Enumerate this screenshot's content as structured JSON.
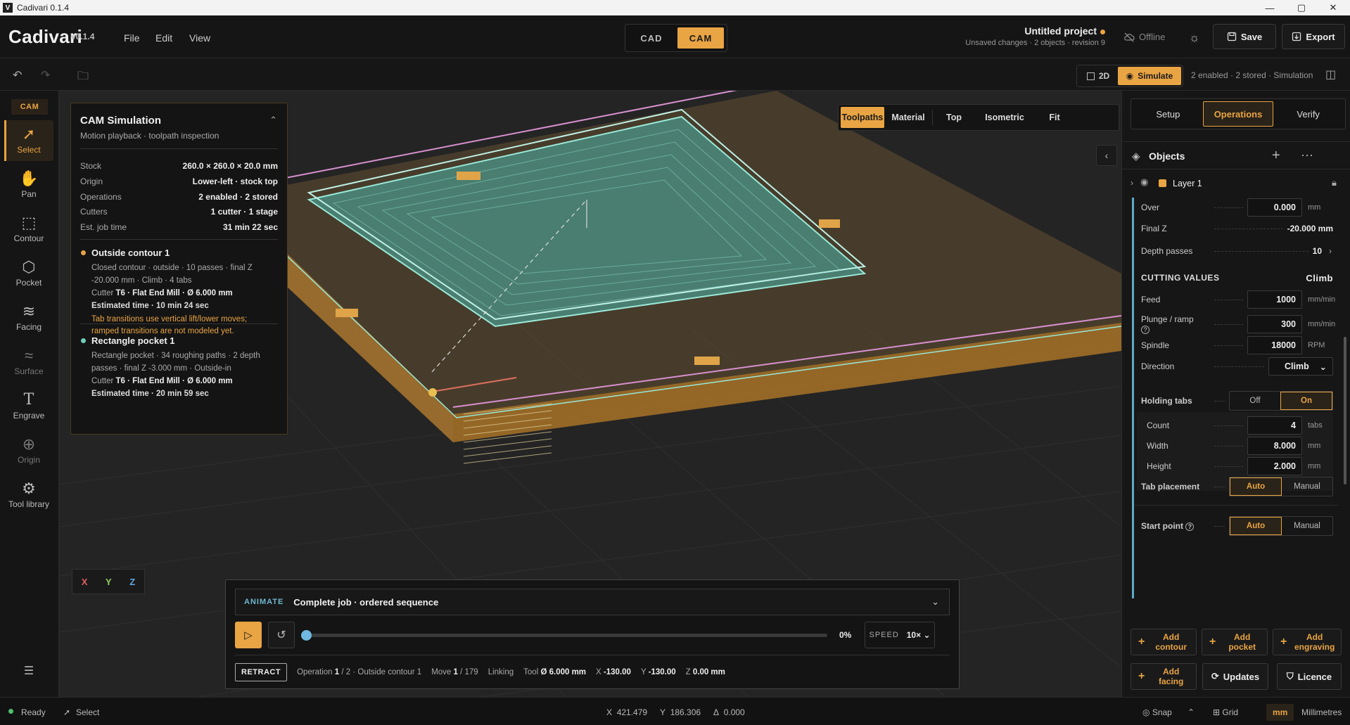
{
  "window": {
    "title": "Cadivari 0.1.4",
    "logo_letter": "V",
    "minimize": "—",
    "maximize": "▢",
    "close": "✕"
  },
  "brand": {
    "name": "Cadivari",
    "version": "v0.1.4"
  },
  "menu": {
    "file": "File",
    "edit": "Edit",
    "view": "View"
  },
  "mode": {
    "cad": "CAD",
    "cam": "CAM"
  },
  "project": {
    "title": "Untitled project",
    "subtitle": "Unsaved changes · 2 objects · revision 9"
  },
  "top_actions": {
    "offline": "Offline",
    "save": "Save",
    "export": "Export"
  },
  "toolbar": {
    "two_d": "2D",
    "simulate": "Simulate",
    "status": "2 enabled · 2 stored · Simulation"
  },
  "leftbar": {
    "badge": "CAM",
    "tools": [
      {
        "label": "Select",
        "icon": "cursor-icon"
      },
      {
        "label": "Pan",
        "icon": "hand-icon"
      },
      {
        "label": "Contour",
        "icon": "contour-icon"
      },
      {
        "label": "Pocket",
        "icon": "pocket-icon"
      },
      {
        "label": "Facing",
        "icon": "facing-icon"
      },
      {
        "label": "Surface",
        "icon": "surface-icon"
      },
      {
        "label": "Engrave",
        "icon": "engrave-icon"
      },
      {
        "label": "Origin",
        "icon": "origin-icon"
      },
      {
        "label": "Tool library",
        "icon": "tool-library-icon"
      }
    ]
  },
  "sim_panel": {
    "title": "CAM Simulation",
    "subtitle": "Motion playback · toolpath inspection",
    "rows": [
      {
        "k": "Stock",
        "v": "260.0 × 260.0 × 20.0 mm"
      },
      {
        "k": "Origin",
        "v": "Lower-left · stock top"
      },
      {
        "k": "Operations",
        "v": "2 enabled · 2 stored"
      },
      {
        "k": "Cutters",
        "v": "1 cutter · 1 stage"
      },
      {
        "k": "Est. job time",
        "v": "31 min 22 sec"
      }
    ],
    "ops": [
      {
        "name": "Outside contour 1",
        "desc1": "Closed contour · outside · 10 passes · final Z",
        "desc2": "-20.000 mm · Climb · 4 tabs",
        "cutter_prefix": "Cutter ",
        "cutter": "T6 · Flat End Mill · Ø 6.000 mm",
        "est": "Estimated time · 10 min 24 sec",
        "warn1": "Tab transitions use vertical lift/lower moves;",
        "warn2": "ramped transitions are not modeled yet."
      },
      {
        "name": "Rectangle pocket 1",
        "desc1": "Rectangle pocket · 34 roughing paths · 2 depth",
        "desc2": "passes · final Z -3.000 mm · Outside-in",
        "cutter_prefix": "Cutter ",
        "cutter": "T6 · Flat End Mill · Ø 6.000 mm",
        "est": "Estimated time · 20 min 59 sec"
      }
    ]
  },
  "view_tabs": {
    "toolpaths": "Toolpaths",
    "material": "Material",
    "top": "Top",
    "isometric": "Isometric",
    "fit": "Fit"
  },
  "axes": {
    "x": "X",
    "y": "Y",
    "z": "Z",
    "x_color": "#e06060",
    "y_color": "#8fd060",
    "z_color": "#60a8e0"
  },
  "animate": {
    "label": "ANIMATE",
    "sequence": "Complete job · ordered sequence",
    "progress_pct": 0,
    "progress_text": "0%",
    "speed_label": "SPEED",
    "speed_value": "10×",
    "retract": "RETRACT",
    "operation_label": "Operation",
    "operation_index": "1",
    "operation_rest": "/ 2 · Outside contour 1",
    "move_label": "Move",
    "move_index": "1",
    "move_rest": "/ 179",
    "linking": "Linking",
    "tool_label": "Tool",
    "tool_value": "Ø 6.000 mm",
    "x_label": "X",
    "x_value": "-130.00",
    "y_label": "Y",
    "y_value": "-130.00",
    "z_label": "Z",
    "z_value": "0.00 mm"
  },
  "right": {
    "tabs": {
      "setup": "Setup",
      "operations": "Operations",
      "verify": "Verify"
    },
    "objects_title": "Objects",
    "layer": "Layer 1",
    "props": {
      "over_label": "Over",
      "over_value": "0.000",
      "over_unit": "mm",
      "finalz_label": "Final Z",
      "finalz_value": "-20.000 mm",
      "depth_label": "Depth passes",
      "depth_value": "10",
      "cutting_title": "CUTTING VALUES",
      "cutting_mode": "Climb",
      "feed_label": "Feed",
      "feed_value": "1000",
      "feed_unit": "mm/min",
      "plunge_label": "Plunge / ramp",
      "plunge_value": "300",
      "plunge_unit": "mm/min",
      "spindle_label": "Spindle",
      "spindle_value": "18000",
      "spindle_unit": "RPM",
      "direction_label": "Direction",
      "direction_value": "Climb",
      "tabs_label": "Holding tabs",
      "tabs_off": "Off",
      "tabs_on": "On",
      "count_label": "Count",
      "count_value": "4",
      "count_unit": "tabs",
      "width_label": "Width",
      "width_value": "8.000",
      "width_unit": "mm",
      "height_label": "Height",
      "height_value": "2.000",
      "height_unit": "mm",
      "placement_label": "Tab placement",
      "placement_auto": "Auto",
      "placement_manual": "Manual",
      "start_label": "Start point",
      "start_auto": "Auto",
      "start_manual": "Manual"
    },
    "buttons": {
      "add_contour_1": "Add",
      "add_contour_2": "contour",
      "add_pocket_1": "Add",
      "add_pocket_2": "pocket",
      "add_engraving_1": "Add",
      "add_engraving_2": "engraving",
      "add_facing_1": "Add",
      "add_facing_2": "facing",
      "updates": "Updates",
      "licence": "Licence"
    }
  },
  "status": {
    "ready": "Ready",
    "select": "Select",
    "x_label": "X",
    "x_value": "421.479",
    "y_label": "Y",
    "y_value": "186.306",
    "d_label": "Δ",
    "d_value": "0.000",
    "snap": "Snap",
    "grid": "Grid",
    "unit_short": "mm",
    "unit_long": "Millimetres"
  },
  "colors": {
    "accent": "#e9a443",
    "toolpath": "#7fd6c2",
    "stock": "#c98a32"
  }
}
